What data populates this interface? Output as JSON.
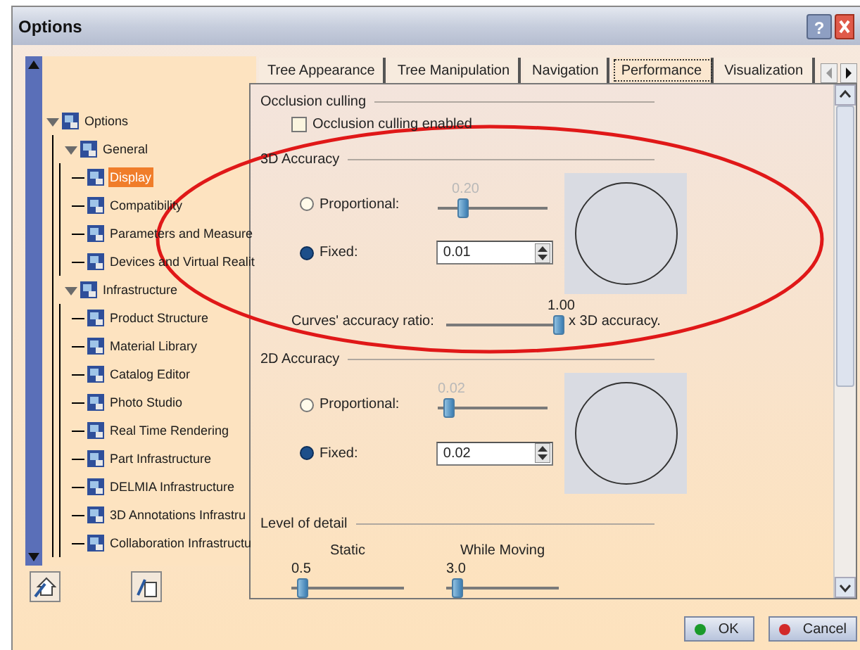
{
  "window": {
    "title": "Options",
    "help": "?"
  },
  "tree": [
    {
      "label": "Options",
      "selected": false,
      "expanded": true,
      "children": [
        {
          "label": "General",
          "selected": false,
          "expanded": true,
          "children": [
            {
              "label": "Display",
              "selected": true
            },
            {
              "label": "Compatibility",
              "selected": false
            },
            {
              "label": "Parameters and Measure",
              "selected": false
            },
            {
              "label": "Devices and Virtual Realit",
              "selected": false
            }
          ]
        },
        {
          "label": "Infrastructure",
          "selected": false,
          "expanded": true,
          "children": [
            {
              "label": "Product Structure",
              "selected": false
            },
            {
              "label": "Material Library",
              "selected": false
            },
            {
              "label": "Catalog Editor",
              "selected": false
            },
            {
              "label": "Photo Studio",
              "selected": false
            },
            {
              "label": "Real Time Rendering",
              "selected": false
            },
            {
              "label": "Part Infrastructure",
              "selected": false
            },
            {
              "label": "DELMIA Infrastructure",
              "selected": false
            },
            {
              "label": "3D Annotations Infrastru",
              "selected": false
            },
            {
              "label": "Collaboration Infrastructu",
              "selected": false
            }
          ]
        }
      ]
    }
  ],
  "tabs": [
    {
      "label": "Tree Appearance",
      "selected": false
    },
    {
      "label": "Tree Manipulation",
      "selected": false
    },
    {
      "label": "Navigation",
      "selected": false
    },
    {
      "label": "Performance",
      "selected": true
    },
    {
      "label": "Visualization",
      "selected": false
    }
  ],
  "occlusion_culling": {
    "title": "Occlusion culling",
    "checkbox": {
      "label": "Occlusion culling enabled",
      "checked": false
    }
  },
  "accuracy_3d": {
    "title": "3D Accuracy",
    "proportional": {
      "label": "Proportional:",
      "selected": false,
      "value": "0.20",
      "level": 0.2
    },
    "fixed": {
      "label": "Fixed:",
      "selected": true,
      "value": "0.01"
    },
    "curves_ratio": {
      "label": "Curves' accuracy ratio:",
      "value": "1.00",
      "level": 1,
      "suffix": "x 3D accuracy."
    }
  },
  "accuracy_2d": {
    "title": "2D Accuracy",
    "proportional": {
      "label": "Proportional:",
      "selected": false,
      "value": "0.02",
      "level": 0.05
    },
    "fixed": {
      "label": "Fixed:",
      "selected": true,
      "value": "0.02"
    }
  },
  "level_of_detail": {
    "title": "Level of detail",
    "sliders": [
      {
        "label": "Static",
        "value": "0.5",
        "level": 0.05
      },
      {
        "label": "While Moving",
        "value": "3.0",
        "level": 0.05
      }
    ]
  },
  "buttons": [
    {
      "label": "OK",
      "kind": "ok"
    },
    {
      "label": "Cancel",
      "kind": "cancel"
    }
  ]
}
